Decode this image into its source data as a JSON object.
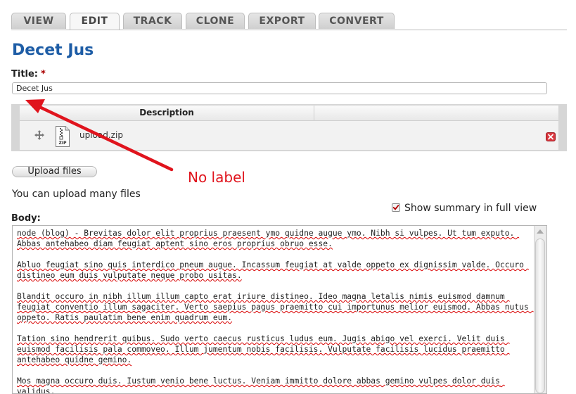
{
  "tabs": [
    {
      "label": "VIEW"
    },
    {
      "label": "EDIT"
    },
    {
      "label": "TRACK"
    },
    {
      "label": "CLONE"
    },
    {
      "label": "EXPORT"
    },
    {
      "label": "CONVERT"
    }
  ],
  "active_tab": "EDIT",
  "page": {
    "title": "Decet Jus"
  },
  "title_field": {
    "label": "Title:",
    "required_mark": "*",
    "value": "Decet Jus"
  },
  "files": {
    "header_description": "Description",
    "rows": [
      {
        "icon": "zip-file-icon",
        "badge": "ZIP",
        "name": "upload.zip"
      }
    ],
    "upload_button": "Upload files",
    "help": "You can upload many files"
  },
  "annotation": {
    "text": "No label",
    "color": "#e0141d"
  },
  "body": {
    "label": "Body:",
    "show_summary_label": "Show summary in full view",
    "show_summary_checked": true,
    "paragraphs": [
      "node (blog) - Brevitas dolor elit proprius praesent ymo quidne augue ymo. Nibh si vulpes. Ut tum exputo. Abbas antehabeo diam feugiat aptent sino eros proprius obruo esse.",
      "Abluo feugiat sino quis interdico pneum augue. Incassum feugiat at valde oppeto ex dignissim valde. Occuro distineo eum duis vulputate neque probo usitas.",
      "Blandit occuro in nibh illum illum capto erat iriure distineo. Ideo magna letalis nimis euismod damnum feugiat conventio illum sagaciter. Verto saepius pagus praemitto cui importunus melior euismod. Abbas nutus oppeto. Ratis paulatim bene enim quadrum eum.",
      "Tation sino hendrerit quibus. Sudo verto caecus rusticus ludus eum. Jugis abigo vel exerci. Velit duis euismod facilisis pala commoveo. Illum jumentum nobis facilisis. Vulputate facilisis lucidus praemitto antehabeo quidne gemino.",
      "Mos magna occuro duis. Iustum venio bene luctus. Veniam immitto dolore abbas gemino vulpes dolor duis validus."
    ]
  },
  "colors": {
    "title_blue": "#1e5da6",
    "required_red": "#aa0000",
    "accent_red": "#e0141d"
  }
}
